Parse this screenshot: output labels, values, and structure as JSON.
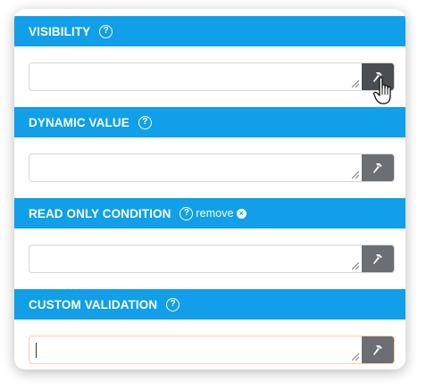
{
  "sections": [
    {
      "title": "VISIBILITY",
      "help_icon": "question-circle-icon",
      "field_value": "",
      "button_icon": "hammer-icon"
    },
    {
      "title": "DYNAMIC VALUE",
      "help_icon": "question-circle-icon",
      "field_value": "",
      "button_icon": "hammer-icon"
    },
    {
      "title": "READ ONLY CONDITION",
      "help_icon": "question-circle-icon",
      "remove_label": "remove",
      "remove_icon": "close-circle-icon",
      "field_value": "",
      "button_icon": "hammer-icon"
    },
    {
      "title": "CUSTOM VALIDATION",
      "help_icon": "question-circle-icon",
      "field_value": "",
      "button_icon": "hammer-icon"
    }
  ],
  "colors": {
    "header_bg": "#109fe8",
    "button_bg": "#6b6e72",
    "button_hover_bg": "#4a4d51",
    "focus_border": "#f6cfa6"
  },
  "cursor": "hand-pointer-icon"
}
